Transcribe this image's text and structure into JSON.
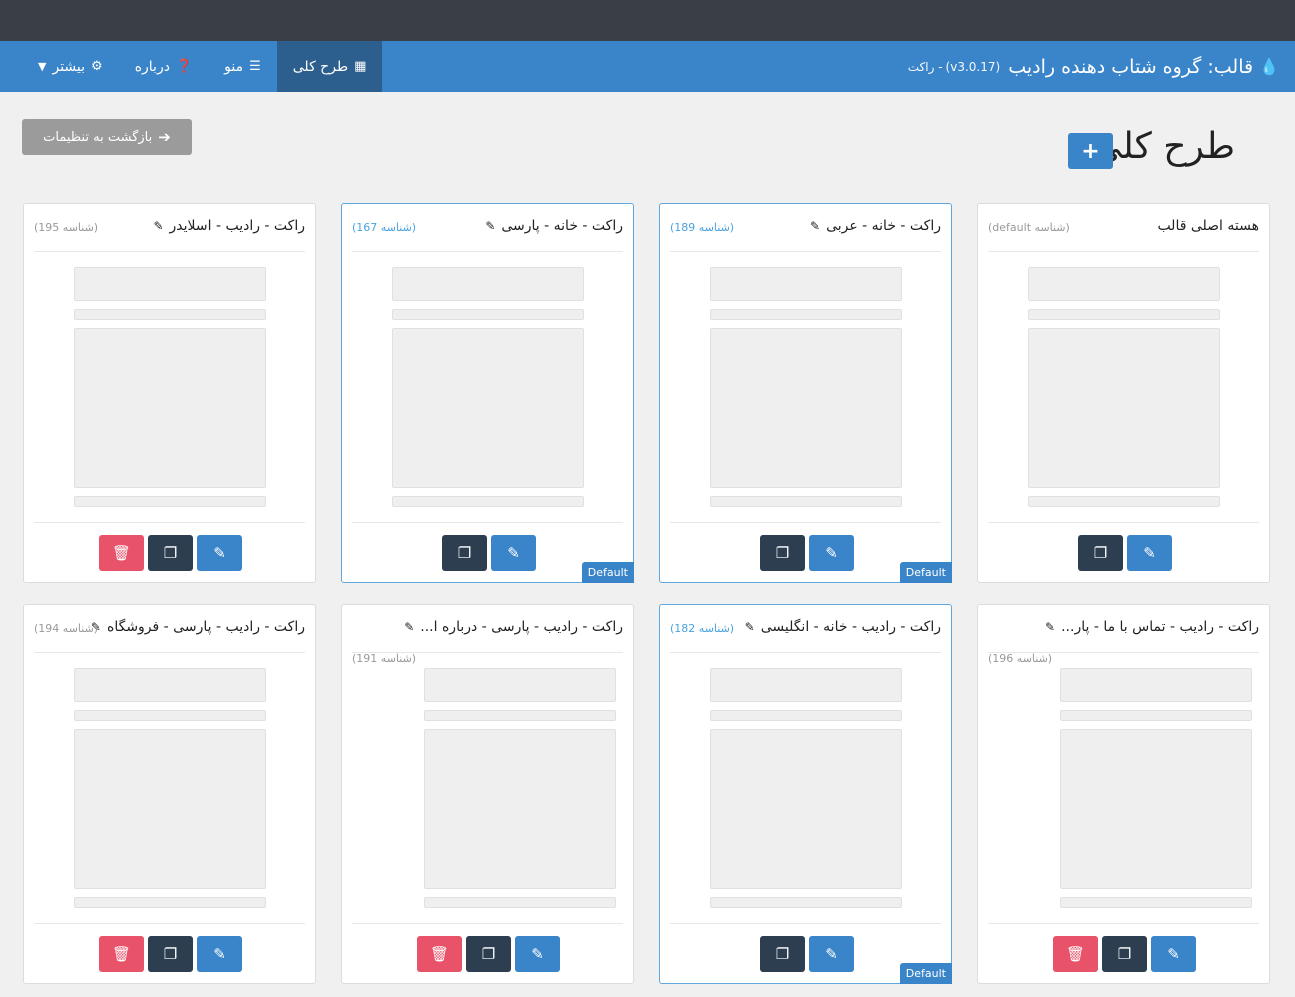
{
  "header": {
    "brand_icon": "drop-icon",
    "brand_prefix": "قالب:",
    "brand_title": "گروه شتاب دهنده رادیب",
    "version": "(v3.0.17)",
    "site": "- راکت"
  },
  "nav": [
    {
      "label": "طرح کلی",
      "icon": "grid-icon",
      "active": true
    },
    {
      "label": "منو",
      "icon": "bars-icon",
      "active": false
    },
    {
      "label": "درباره",
      "icon": "question-circle-icon",
      "active": false
    },
    {
      "label": "بیشتر",
      "icon": "gear-icon",
      "active": false,
      "caret": "chevron-down-icon"
    }
  ],
  "page": {
    "title": "طرح کلی",
    "add_label": "+",
    "back_label": "بازگشت به تنظیمات"
  },
  "cards": [
    {
      "title": "هسته اصلی قالب",
      "id_label": "(شناسه default)",
      "editable_title": false,
      "default": false,
      "deletable": false,
      "highlight": false
    },
    {
      "title": "راکت - خانه - عربی",
      "id_label": "(شناسه 189)",
      "editable_title": true,
      "default": true,
      "deletable": false,
      "highlight": true
    },
    {
      "title": "راکت - خانه - پارسی",
      "id_label": "(شناسه 167)",
      "editable_title": true,
      "default": true,
      "deletable": false,
      "highlight": true
    },
    {
      "title": "راکت - رادیب - اسلایدر",
      "id_label": "(شناسه 195)",
      "editable_title": true,
      "default": false,
      "deletable": true,
      "highlight": false
    },
    {
      "title": "راکت - رادیب - تماس با ما - پار...",
      "id_label": "(شناسه 196)",
      "editable_title": true,
      "default": false,
      "deletable": true,
      "highlight": false
    },
    {
      "title": "راکت - رادیب - خانه - انگلیسی",
      "id_label": "(شناسه 182)",
      "editable_title": true,
      "default": true,
      "deletable": false,
      "highlight": true
    },
    {
      "title": "راکت - رادیب - پارسی - درباره ا...",
      "id_label": "(شناسه 191)",
      "editable_title": true,
      "default": false,
      "deletable": true,
      "highlight": false
    },
    {
      "title": "راکت - رادیب - پارسی - فروشگاه",
      "id_label": "(شناسه 194)",
      "editable_title": true,
      "default": false,
      "deletable": true,
      "highlight": false
    }
  ],
  "labels": {
    "default_badge": "Default"
  }
}
